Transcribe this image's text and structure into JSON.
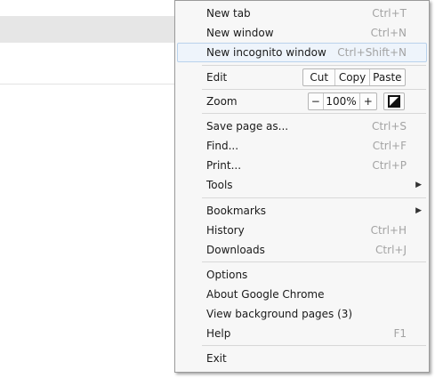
{
  "menu": {
    "new_tab": {
      "label": "New tab",
      "shortcut": "Ctrl+T"
    },
    "new_window": {
      "label": "New window",
      "shortcut": "Ctrl+N"
    },
    "new_incognito": {
      "label": "New incognito window",
      "shortcut": "Ctrl+Shift+N"
    },
    "edit": {
      "label": "Edit",
      "cut": "Cut",
      "copy": "Copy",
      "paste": "Paste"
    },
    "zoom": {
      "label": "Zoom",
      "minus": "−",
      "value": "100%",
      "plus": "+",
      "fullscreen_icon": "fullscreen-icon"
    },
    "save_page": {
      "label": "Save page as...",
      "shortcut": "Ctrl+S"
    },
    "find": {
      "label": "Find...",
      "shortcut": "Ctrl+F"
    },
    "print": {
      "label": "Print...",
      "shortcut": "Ctrl+P"
    },
    "tools": {
      "label": "Tools",
      "arrow": "▶"
    },
    "bookmarks": {
      "label": "Bookmarks",
      "arrow": "▶"
    },
    "history": {
      "label": "History",
      "shortcut": "Ctrl+H"
    },
    "downloads": {
      "label": "Downloads",
      "shortcut": "Ctrl+J"
    },
    "options": {
      "label": "Options"
    },
    "about": {
      "label": "About Google Chrome"
    },
    "background_pages": {
      "label": "View background pages (3)"
    },
    "help": {
      "label": "Help",
      "shortcut": "F1"
    },
    "exit": {
      "label": "Exit"
    }
  },
  "colors": {
    "highlight_bg": "#eef4fb",
    "highlight_border": "#b9d2ec",
    "shortcut": "#a3a3a3"
  }
}
